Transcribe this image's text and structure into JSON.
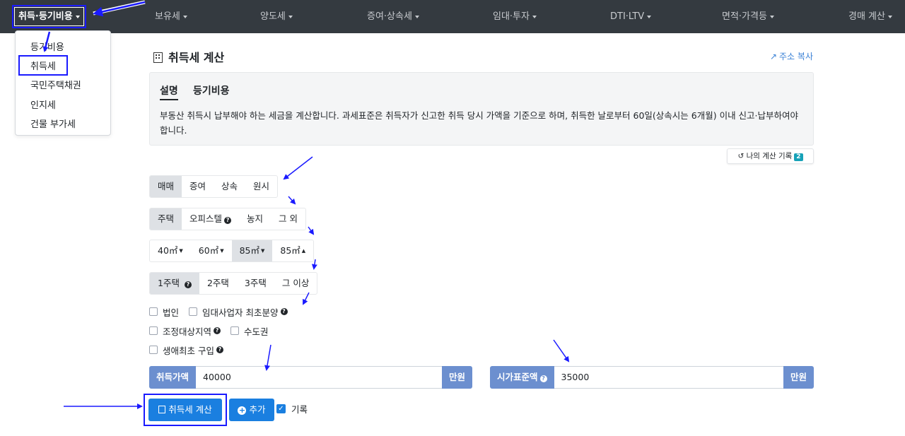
{
  "navbar": {
    "items": [
      {
        "label": "취득·등기비용",
        "active": true
      },
      {
        "label": "보유세"
      },
      {
        "label": "양도세"
      },
      {
        "label": "증여·상속세"
      },
      {
        "label": "임대·투자"
      },
      {
        "label": "DTI·LTV"
      },
      {
        "label": "면적·가격등"
      },
      {
        "label": "경매 계산"
      }
    ]
  },
  "dropdown": {
    "items": [
      "등기비용",
      "취득세",
      "국민주택채권",
      "인지세",
      "건물 부가세"
    ]
  },
  "page": {
    "title": "취득세 계산",
    "share_link": "주소 복사"
  },
  "info": {
    "tabs": [
      "설명",
      "등기비용"
    ],
    "text": "부동산 취득시 납부해야 하는 세금을 계산합니다. 과세표준은 취득자가 신고한 취득 당시 가액을 기준으로 하며, 취득한 날로부터 60일(상속시는 6개월) 이내 신고·납부하여야 합니다."
  },
  "history": {
    "label": "나의 계산 기록",
    "count": "2"
  },
  "groups": {
    "transaction": [
      "매매",
      "증여",
      "상속",
      "원시"
    ],
    "property": [
      "주택",
      "오피스텔",
      "농지",
      "그 외"
    ],
    "area": [
      "40㎡",
      "60㎡",
      "85㎡",
      "85㎡"
    ],
    "houses": [
      "1주택",
      "2주택",
      "3주택",
      "그 이상"
    ]
  },
  "checks": {
    "corporation": "법인",
    "rental_first_sale": "임대사업자 최초분양",
    "adjusted_area": "조정대상지역",
    "capital_area": "수도권",
    "first_home": "생애최초 구입"
  },
  "inputs": {
    "acquisition": {
      "label": "취득가액",
      "value": "40000",
      "unit": "만원"
    },
    "standard": {
      "label": "시가표준액",
      "value": "35000",
      "unit": "만원"
    }
  },
  "actions": {
    "calculate": "취득세 계산",
    "add": "추가",
    "record": "기록"
  },
  "colors": {
    "navbar": "#343a40",
    "primary": "#1a7fe0",
    "addon": "#6c8fcf",
    "annotation": "#1a1aff"
  }
}
